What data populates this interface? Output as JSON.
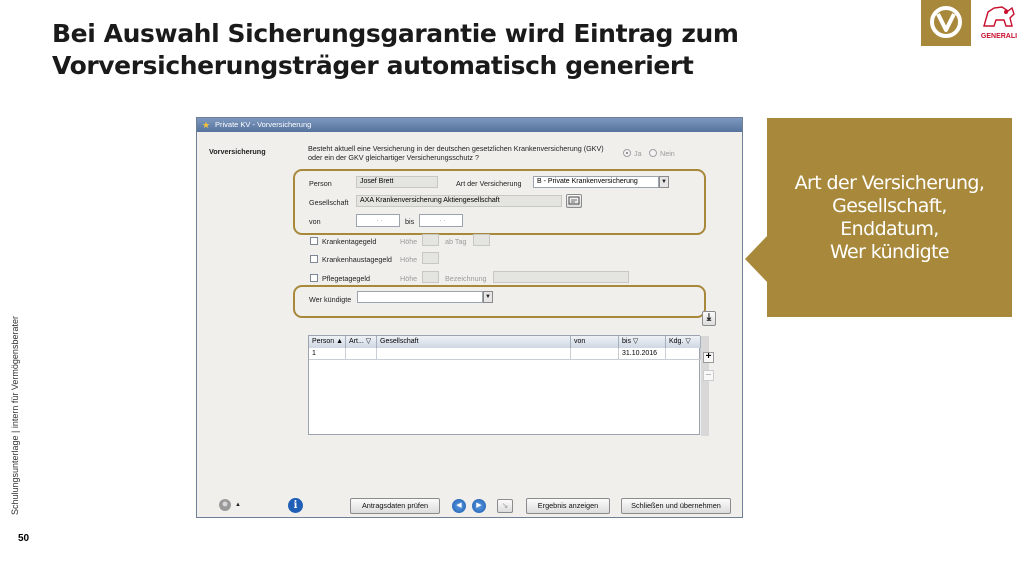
{
  "slide": {
    "title_line1": "Bei Auswahl Sicherungsgarantie wird Eintrag zum",
    "title_line2": "Vorversicherungsträger automatisch generiert",
    "side_text": "Schulungsunterlage | intern für Vermögensberater",
    "page_number": "50",
    "logo_generali": "GENERALI",
    "accent_color": "#a8893b"
  },
  "window": {
    "title": "Private KV - Vorversicherung",
    "section_label": "Vorversicherung",
    "question_line1": "Besteht aktuell eine Versicherung in der deutschen gesetzlichen Krankenversicherung (GKV)",
    "question_line2": "oder ein der GKV gleichartiger Versicherungsschutz ?",
    "radio_yes": "Ja",
    "radio_no": "Nein",
    "person_label": "Person",
    "person_value": "Josef Brett",
    "art_label": "Art der Versicherung",
    "art_value": "B - Private Krankenversicherung",
    "gesellschaft_label": "Gesellschaft",
    "gesellschaft_value": "AXA Krankenversicherung Aktiengesellschaft",
    "von_label": "von",
    "von_value": ". .",
    "bis_label": "bis",
    "bis_value": ". .",
    "krankentagegeld": "Krankentagegeld",
    "hoehe1": "Höhe",
    "ab_tag": "ab Tag",
    "krankenhaustagegeld": "Krankenhaustagegeld",
    "hoehe2": "Höhe",
    "pflegetagegeld": "Pflegetagegeld",
    "hoehe3": "Höhe",
    "bezeichnung": "Bezeichnung",
    "wer_kuendigte_label": "Wer kündigte",
    "wer_kuendigte_value": ""
  },
  "table": {
    "columns": [
      "Person ▲",
      "Art... ▽",
      "Gesellschaft",
      "von",
      "bis ▽",
      "Kdg. ▽"
    ],
    "rows": [
      [
        "1",
        "",
        "",
        "",
        "31.10.2016",
        ""
      ]
    ]
  },
  "buttons": {
    "antragsdaten": "Antragsdaten prüfen",
    "ergebnis": "Ergebnis anzeigen",
    "schliessen": "Schließen und übernehmen"
  },
  "callout": {
    "line1": "Art der Versicherung,",
    "line2": "Gesellschaft,",
    "line3": "Enddatum,",
    "line4": "Wer kündigte"
  }
}
